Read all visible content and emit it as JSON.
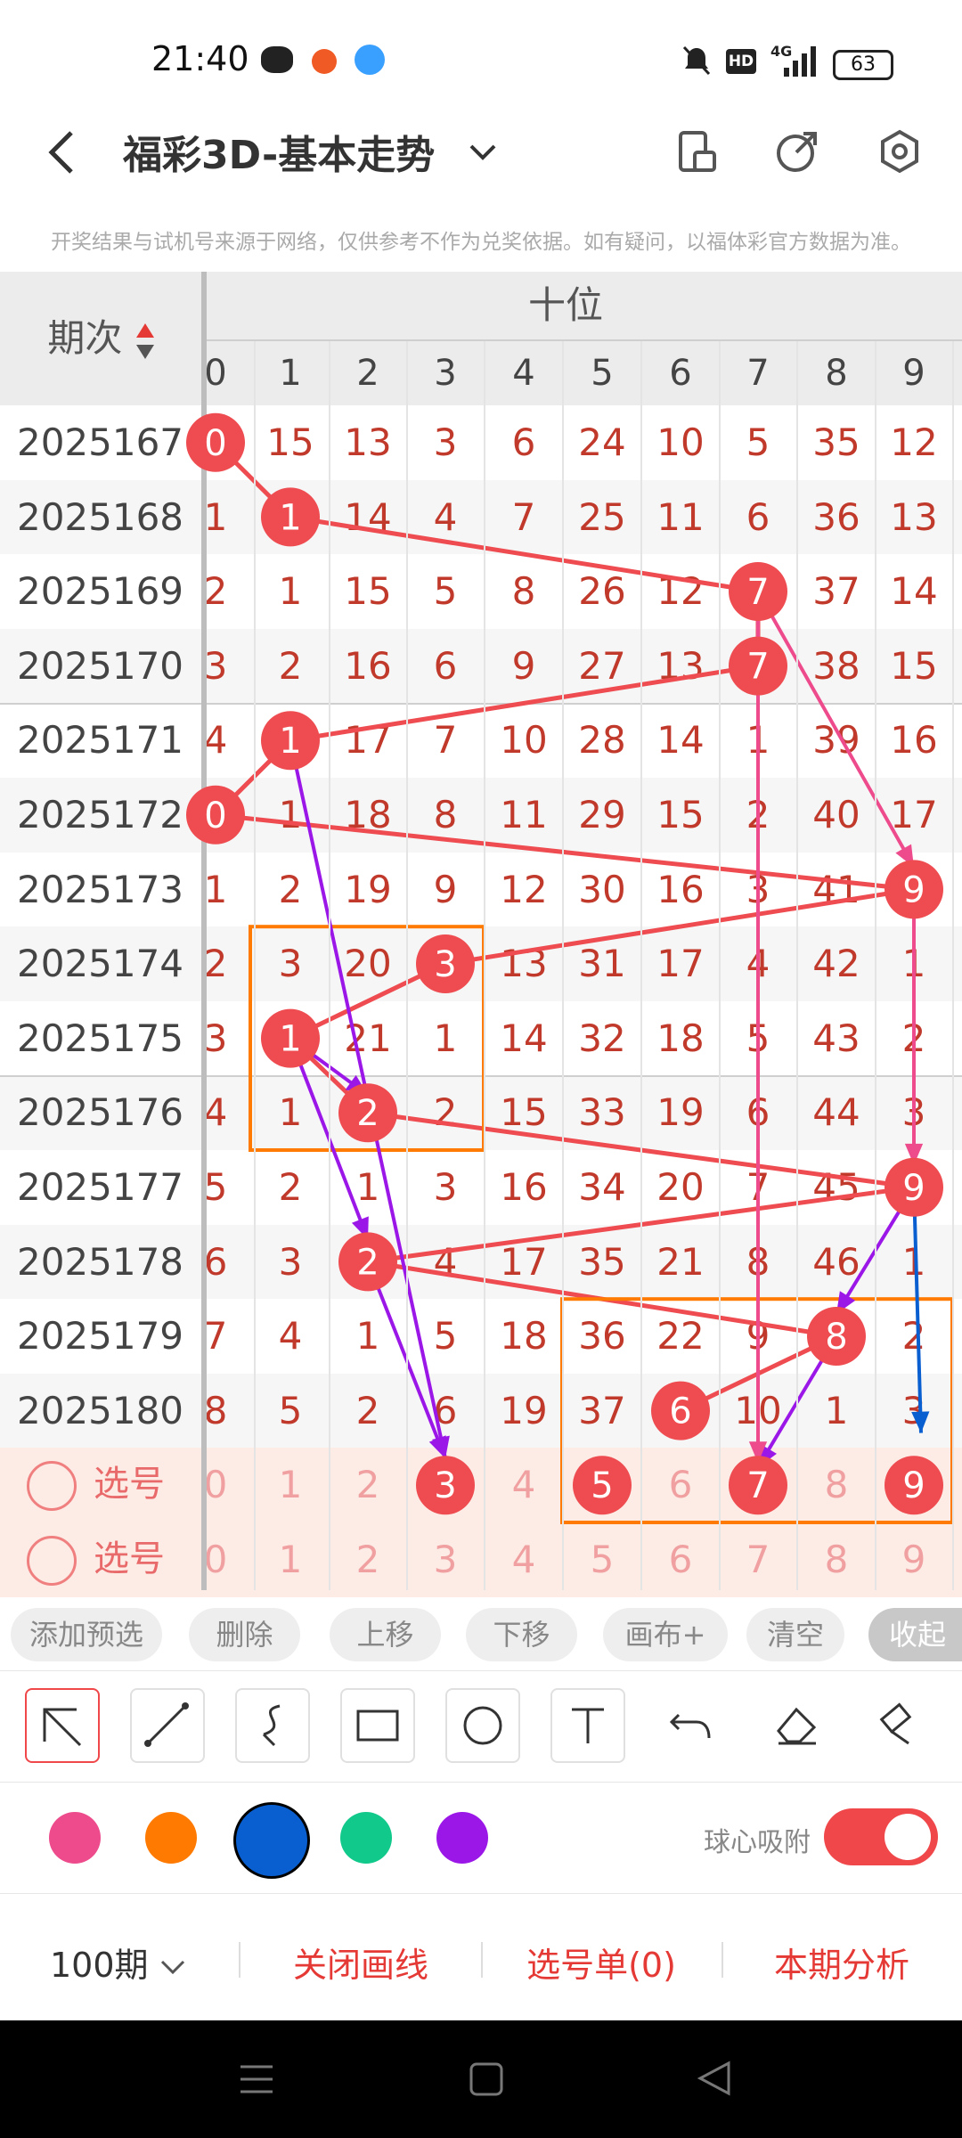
{
  "status": {
    "time": "21:40",
    "battery": "63",
    "hd": "HD",
    "net": "4G"
  },
  "header": {
    "title": "福彩3D-基本走势"
  },
  "notice": "开奖结果与试机号来源于网络，仅供参考不作为兑奖依据。如有疑问，以福体彩官方数据为准。",
  "table": {
    "period_header": "期次",
    "group_header": "十位",
    "digits": [
      "0",
      "1",
      "2",
      "3",
      "4",
      "5",
      "6",
      "7",
      "8",
      "9"
    ],
    "rows": [
      {
        "period": "2025167",
        "vals": [
          "0",
          "15",
          "13",
          "3",
          "6",
          "24",
          "10",
          "5",
          "35",
          "12"
        ]
      },
      {
        "period": "2025168",
        "vals": [
          "1",
          "1",
          "14",
          "4",
          "7",
          "25",
          "11",
          "6",
          "36",
          "13"
        ]
      },
      {
        "period": "2025169",
        "vals": [
          "2",
          "1",
          "15",
          "5",
          "8",
          "26",
          "12",
          "7",
          "37",
          "14"
        ]
      },
      {
        "period": "2025170",
        "vals": [
          "3",
          "2",
          "16",
          "6",
          "9",
          "27",
          "13",
          "7",
          "38",
          "15"
        ]
      },
      {
        "period": "2025171",
        "vals": [
          "4",
          "1",
          "17",
          "7",
          "10",
          "28",
          "14",
          "1",
          "39",
          "16"
        ]
      },
      {
        "period": "2025172",
        "vals": [
          "0",
          "1",
          "18",
          "8",
          "11",
          "29",
          "15",
          "2",
          "40",
          "17"
        ]
      },
      {
        "period": "2025173",
        "vals": [
          "1",
          "2",
          "19",
          "9",
          "12",
          "30",
          "16",
          "3",
          "41",
          "9"
        ]
      },
      {
        "period": "2025174",
        "vals": [
          "2",
          "3",
          "20",
          "3",
          "13",
          "31",
          "17",
          "4",
          "42",
          "1"
        ]
      },
      {
        "period": "2025175",
        "vals": [
          "3",
          "1",
          "21",
          "1",
          "14",
          "32",
          "18",
          "5",
          "43",
          "2"
        ]
      },
      {
        "period": "2025176",
        "vals": [
          "4",
          "1",
          "2",
          "2",
          "15",
          "33",
          "19",
          "6",
          "44",
          "3"
        ]
      },
      {
        "period": "2025177",
        "vals": [
          "5",
          "2",
          "1",
          "3",
          "16",
          "34",
          "20",
          "7",
          "45",
          "9"
        ]
      },
      {
        "period": "2025178",
        "vals": [
          "6",
          "3",
          "2",
          "4",
          "17",
          "35",
          "21",
          "8",
          "46",
          "1"
        ]
      },
      {
        "period": "2025179",
        "vals": [
          "7",
          "4",
          "1",
          "5",
          "18",
          "36",
          "22",
          "9",
          "8",
          "2"
        ]
      },
      {
        "period": "2025180",
        "vals": [
          "8",
          "5",
          "2",
          "6",
          "19",
          "37",
          "6",
          "10",
          "1",
          "3"
        ]
      }
    ],
    "pick_rows": [
      {
        "label": "选号",
        "vals": [
          "0",
          "1",
          "2",
          "3",
          "4",
          "5",
          "6",
          "7",
          "8",
          "9"
        ]
      },
      {
        "label": "选号",
        "vals": [
          "0",
          "1",
          "2",
          "3",
          "4",
          "5",
          "6",
          "7",
          "8",
          "9"
        ]
      }
    ]
  },
  "chips": [
    "添加预选",
    "删除",
    "上移",
    "下移",
    "画布+",
    "清空",
    "收起"
  ],
  "tools": [
    "arrow-tool",
    "line-tool",
    "curve-tool",
    "rect-tool",
    "circle-tool",
    "text-tool",
    "undo-tool",
    "eraser-tool",
    "clear-tool"
  ],
  "colors": [
    "#ee4b8d",
    "#ff7a00",
    "#0a5fd0",
    "#12c98c",
    "#9b17e8"
  ],
  "snap": {
    "label": "球心吸附",
    "on": true
  },
  "bottom": {
    "period_select": "100期",
    "close_draw": "关闭画线",
    "pick_list": "选号单(0)",
    "analysis": "本期分析"
  }
}
